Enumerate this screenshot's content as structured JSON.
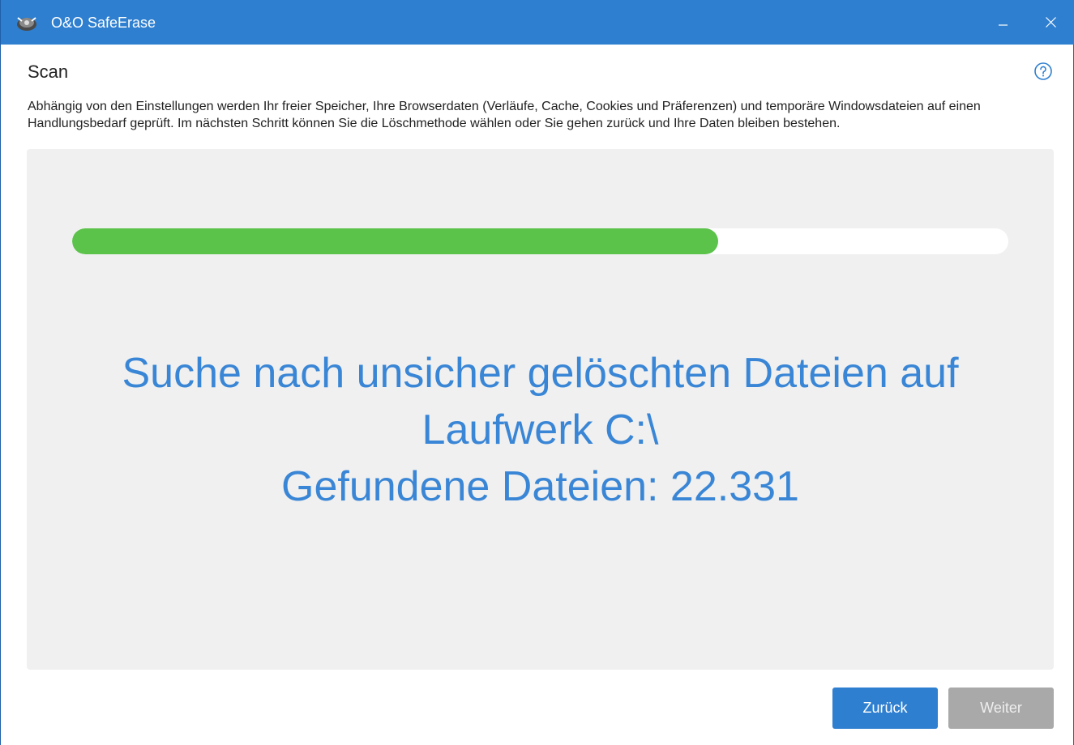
{
  "window": {
    "title": "O&O SafeErase",
    "icons": {
      "app": "oo-safeerase-app-icon",
      "minimize": "minimize-icon",
      "close": "close-icon"
    },
    "colors": {
      "titlebar": "#2f7fd0",
      "accent_text": "#3a86d6",
      "progress_fill": "#5bc24a"
    }
  },
  "page": {
    "title": "Scan",
    "help_icon": "help-icon",
    "description": "Abhängig von den Einstellungen werden Ihr freier Speicher, Ihre Browserdaten (Verläufe, Cache, Cookies und Präferenzen) und temporäre Windowsdateien auf einen Handlungsbedarf geprüft. Im nächsten Schritt können Sie die Löschmethode wählen oder Sie gehen zurück und Ihre Daten bleiben bestehen."
  },
  "scan": {
    "progress_fraction": 0.69,
    "status_line1": "Suche nach unsicher gelöschten Dateien auf",
    "status_line2": "Laufwerk C:\\",
    "status_line3": "Gefundene Dateien: 22.331"
  },
  "buttons": {
    "back_label": "Zurück",
    "next_label": "Weiter",
    "next_enabled": false
  }
}
